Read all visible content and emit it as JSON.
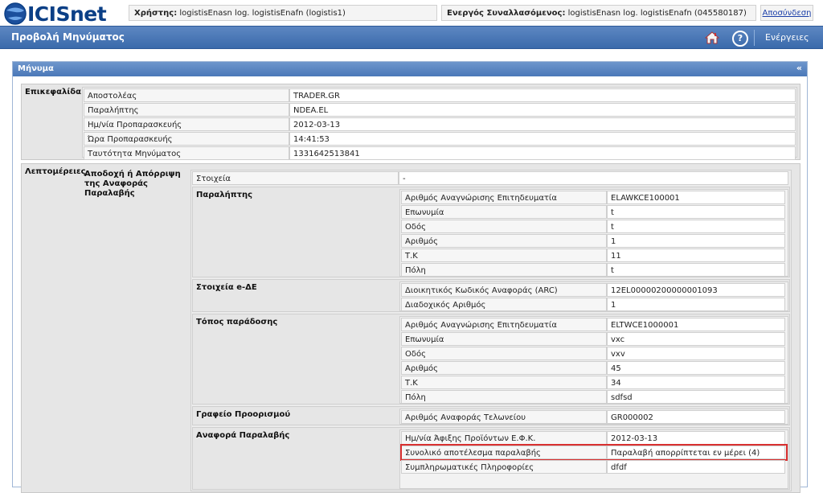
{
  "app": {
    "logo": "ICISnet"
  },
  "top": {
    "user_label": "Χρήστης:",
    "user_value": "logistisEnasn log. logistisEnafn (logistis1)",
    "trader_label": "Ενεργός Συναλλασόμενος:",
    "trader_value": "logistisEnasn log. logistisEnafn (045580187)",
    "logout": "Αποσύνδεση"
  },
  "nav": {
    "title": "Προβολή Μηνύματος",
    "help": "?",
    "actions": "Ενέργειες",
    "icons": [
      "home-icon",
      "help-icon"
    ]
  },
  "panel": {
    "title": "Μήνυμα",
    "collapse": "«"
  },
  "header_section": {
    "title": "Επικεφαλίδα",
    "rows": [
      {
        "label": "Αποστολέας",
        "value": "TRADER.GR"
      },
      {
        "label": "Παραλήπτης",
        "value": "NDEA.EL"
      },
      {
        "label": "Ημ/νία Προπαρασκευής",
        "value": "2012-03-13"
      },
      {
        "label": "Ώρα Προπαρασκευής",
        "value": "14:41:53"
      },
      {
        "label": "Ταυτότητα Μηνύματος",
        "value": "1331642513841"
      }
    ]
  },
  "details_section": {
    "title": "Λεπτομέρειες",
    "subtitle": "Αποδοχή ή Απόρριψη της Αναφοράς Παραλαβής",
    "stoixeia": {
      "label": "Στοιχεία",
      "value": "-"
    },
    "groups": [
      {
        "title": "Παραλήπτης",
        "rows": [
          {
            "label": "Αριθμός Αναγνώρισης Επιτηδευματία",
            "value": "ELAWKCE100001"
          },
          {
            "label": "Επωνυμία",
            "value": "t"
          },
          {
            "label": "Οδός",
            "value": "t"
          },
          {
            "label": "Αριθμός",
            "value": "1"
          },
          {
            "label": "Τ.Κ",
            "value": "11"
          },
          {
            "label": "Πόλη",
            "value": "t"
          }
        ]
      },
      {
        "title": "Στοιχεία e-ΔΕ",
        "rows": [
          {
            "label": "Διοικητικός Κωδικός Αναφοράς (ARC)",
            "value": "12EL00000200000001093"
          },
          {
            "label": "Διαδοχικός Αριθμός",
            "value": "1"
          }
        ]
      },
      {
        "title": "Τόπος παράδοσης",
        "rows": [
          {
            "label": "Αριθμός Αναγνώρισης Επιτηδευματία",
            "value": "ELTWCE1000001"
          },
          {
            "label": "Επωνυμία",
            "value": "vxc"
          },
          {
            "label": "Οδός",
            "value": "vxv"
          },
          {
            "label": "Αριθμός",
            "value": "45"
          },
          {
            "label": "Τ.Κ",
            "value": "34"
          },
          {
            "label": "Πόλη",
            "value": "sdfsd"
          }
        ]
      },
      {
        "title": "Γραφείο Προορισμού",
        "rows": [
          {
            "label": "Αριθμός Αναφοράς Τελωνείου",
            "value": "GR000002"
          }
        ]
      },
      {
        "title": "Αναφορά Παραλαβής",
        "rows": [
          {
            "label": "Ημ/νία Άφιξης Προϊόντων Ε.Φ.Κ.",
            "value": "2012-03-13"
          },
          {
            "label": "Συνολικό αποτέλεσμα παραλαβής",
            "value": "Παραλαβή απορρίπτεται εν μέρει (4)"
          },
          {
            "label": "Συμπληρωματικές Πληροφορίες",
            "value": "dfdf"
          }
        ]
      }
    ]
  }
}
